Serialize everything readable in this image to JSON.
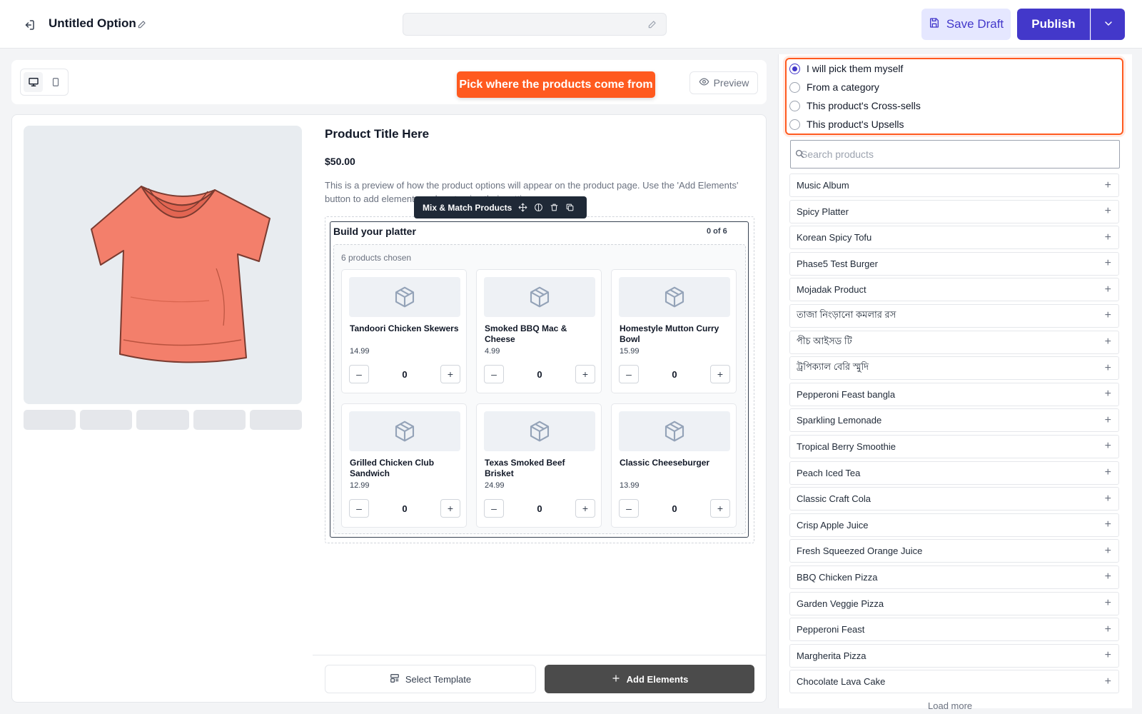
{
  "header": {
    "title": "Untitled Option",
    "save_draft_label": "Save Draft",
    "publish_label": "Publish"
  },
  "canvas": {
    "callout": "Pick where the products come from",
    "preview_label": "Preview",
    "product_title": "Product Title Here",
    "product_price": "$50.00",
    "product_description": "This is a preview of how the product options will appear on the product page. Use the 'Add Elements' button to add elements and customize their settings.",
    "element_toolbar_label": "Mix & Match Products",
    "mix_match": {
      "heading": "Build your platter",
      "count": "0 of 6",
      "chosen_label": "6 products chosen",
      "items": [
        {
          "name": "Tandoori Chicken Skewers",
          "price": "14.99",
          "qty": "0"
        },
        {
          "name": "Smoked BBQ Mac & Cheese",
          "price": "4.99",
          "qty": "0"
        },
        {
          "name": "Homestyle Mutton Curry Bowl",
          "price": "15.99",
          "qty": "0"
        },
        {
          "name": "Grilled Chicken Club Sandwich",
          "price": "12.99",
          "qty": "0"
        },
        {
          "name": "Texas Smoked Beef Brisket",
          "price": "24.99",
          "qty": "0"
        },
        {
          "name": "Classic Cheeseburger",
          "price": "13.99",
          "qty": "0"
        }
      ]
    },
    "select_template_label": "Select Template",
    "add_elements_label": "Add Elements"
  },
  "panel": {
    "source_options": [
      {
        "label": "I will pick them myself",
        "selected": true
      },
      {
        "label": "From a category",
        "selected": false
      },
      {
        "label": "This product's Cross-sells",
        "selected": false
      },
      {
        "label": "This product's Upsells",
        "selected": false
      }
    ],
    "search_placeholder": "Search products",
    "products": [
      "Music Album",
      "Spicy Platter",
      "Korean Spicy Tofu",
      "Phase5 Test Burger",
      "Mojadak Product",
      "তাজা নিংড়ানো কমলার রস",
      "পীচ আইসড টি",
      "ট্রপিক্যাল বেরি স্মুদি",
      "Pepperoni Feast bangla",
      "Sparkling Lemonade",
      "Tropical Berry Smoothie",
      "Peach Iced Tea",
      "Classic Craft Cola",
      "Crisp Apple Juice",
      "Fresh Squeezed Orange Juice",
      "BBQ Chicken Pizza",
      "Garden Veggie Pizza",
      "Pepperoni Feast",
      "Margherita Pizza",
      "Chocolate Lava Cake"
    ],
    "load_more_label": "Load more"
  },
  "colors": {
    "accent": "#4338ca",
    "highlight": "#ff5a1f"
  }
}
